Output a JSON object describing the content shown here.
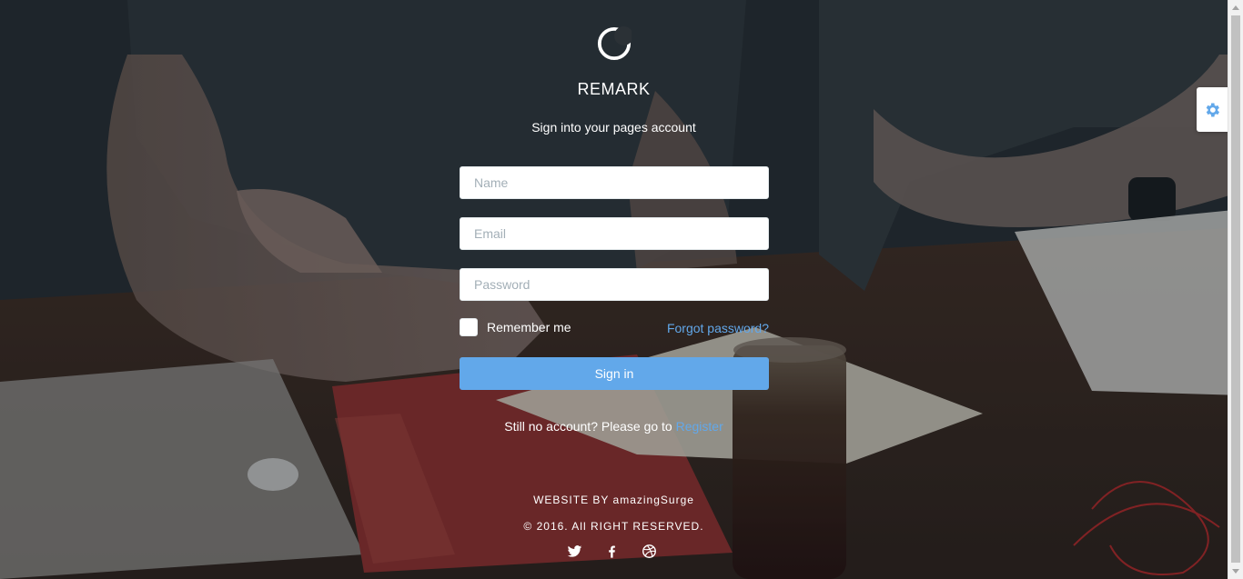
{
  "brand": {
    "logo_icon": "moon-icon",
    "name": "REMARK",
    "subtitle": "Sign into your pages account"
  },
  "form": {
    "name_placeholder": "Name",
    "email_placeholder": "Email",
    "password_placeholder": "Password",
    "remember_label": "Remember me",
    "remember_checked": false,
    "forgot_label": "Forgot password?",
    "signin_label": "Sign in"
  },
  "register": {
    "prefix": "Still no account? Please go to ",
    "link_label": "Register"
  },
  "footer": {
    "website_by": "WEBSITE BY amazingSurge",
    "copyright": "© 2016. All RIGHT RESERVED.",
    "social_icons": [
      "twitter-icon",
      "facebook-icon",
      "dribbble-icon"
    ]
  },
  "settings": {
    "icon": "gear-icon"
  },
  "colors": {
    "accent": "#62a8ea",
    "text": "#ffffff"
  }
}
